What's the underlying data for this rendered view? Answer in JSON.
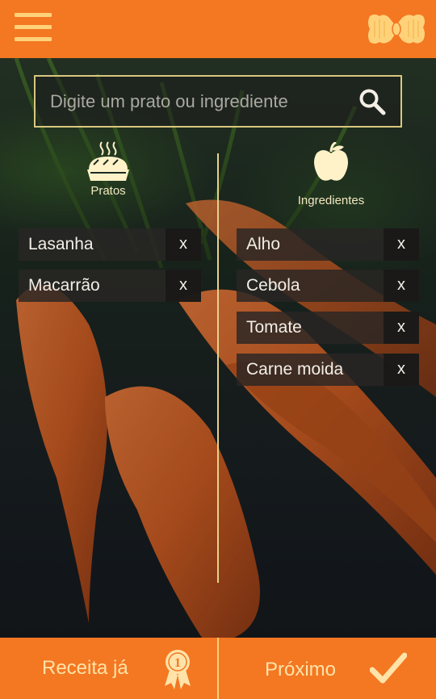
{
  "search": {
    "placeholder": "Digite um prato ou ingrediente"
  },
  "columns": {
    "pratos": {
      "label": "Pratos"
    },
    "ingredientes": {
      "label": "Ingredientes"
    }
  },
  "pratos": [
    {
      "label": "Lasanha",
      "remove": "x"
    },
    {
      "label": "Macarrão",
      "remove": "x"
    }
  ],
  "ingredientes": [
    {
      "label": "Alho",
      "remove": "x"
    },
    {
      "label": "Cebola",
      "remove": "x"
    },
    {
      "label": "Tomate",
      "remove": "x"
    },
    {
      "label": "Carne moida",
      "remove": "x"
    }
  ],
  "footer": {
    "receita_label": "Receita já",
    "proximo_label": "Próximo",
    "medal_number": "1"
  },
  "colors": {
    "accent": "#f47722",
    "highlight": "#ffd27a",
    "chip_bg": "#2a2826"
  },
  "icons": [
    "menu-icon",
    "pasta-icon",
    "search-icon",
    "pie-icon",
    "apple-icon",
    "medal-icon",
    "check-icon"
  ]
}
